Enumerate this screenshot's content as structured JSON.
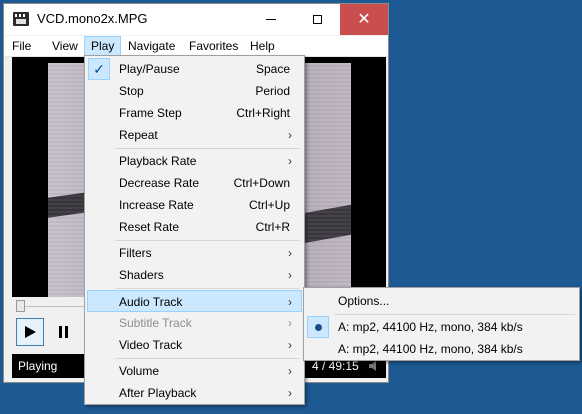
{
  "window": {
    "title": "VCD.mono2x.MPG",
    "close_glyph": "✕"
  },
  "menubar": [
    "File",
    "View",
    "Play",
    "Navigate",
    "Favorites",
    "Help"
  ],
  "player": {
    "status": "Playing",
    "time": "4 / 49:15",
    "seek_position": 0.0
  },
  "play_menu": {
    "play_pause": {
      "label": "Play/Pause",
      "shortcut": "Space"
    },
    "stop": {
      "label": "Stop",
      "shortcut": "Period"
    },
    "frame_step": {
      "label": "Frame Step",
      "shortcut": "Ctrl+Right"
    },
    "repeat": {
      "label": "Repeat"
    },
    "playback_rate": {
      "label": "Playback Rate"
    },
    "decrease_rate": {
      "label": "Decrease Rate",
      "shortcut": "Ctrl+Down"
    },
    "increase_rate": {
      "label": "Increase Rate",
      "shortcut": "Ctrl+Up"
    },
    "reset_rate": {
      "label": "Reset Rate",
      "shortcut": "Ctrl+R"
    },
    "filters": {
      "label": "Filters"
    },
    "shaders": {
      "label": "Shaders"
    },
    "audio_track": {
      "label": "Audio Track"
    },
    "subtitle_track": {
      "label": "Subtitle Track"
    },
    "video_track": {
      "label": "Video Track"
    },
    "volume": {
      "label": "Volume"
    },
    "after_playback": {
      "label": "After Playback"
    },
    "check_glyph": "✓",
    "arrow_glyph": "›"
  },
  "audio_submenu": {
    "options": "Options...",
    "tracks": [
      {
        "label": "A: mp2, 44100 Hz, mono, 384 kb/s",
        "selected": true
      },
      {
        "label": "A: mp2, 44100 Hz, mono, 384 kb/s",
        "selected": false
      }
    ]
  },
  "colors": {
    "desktop": "#1d5a93",
    "close_button": "#c94f4f",
    "menu_highlight": "#cce8ff"
  }
}
